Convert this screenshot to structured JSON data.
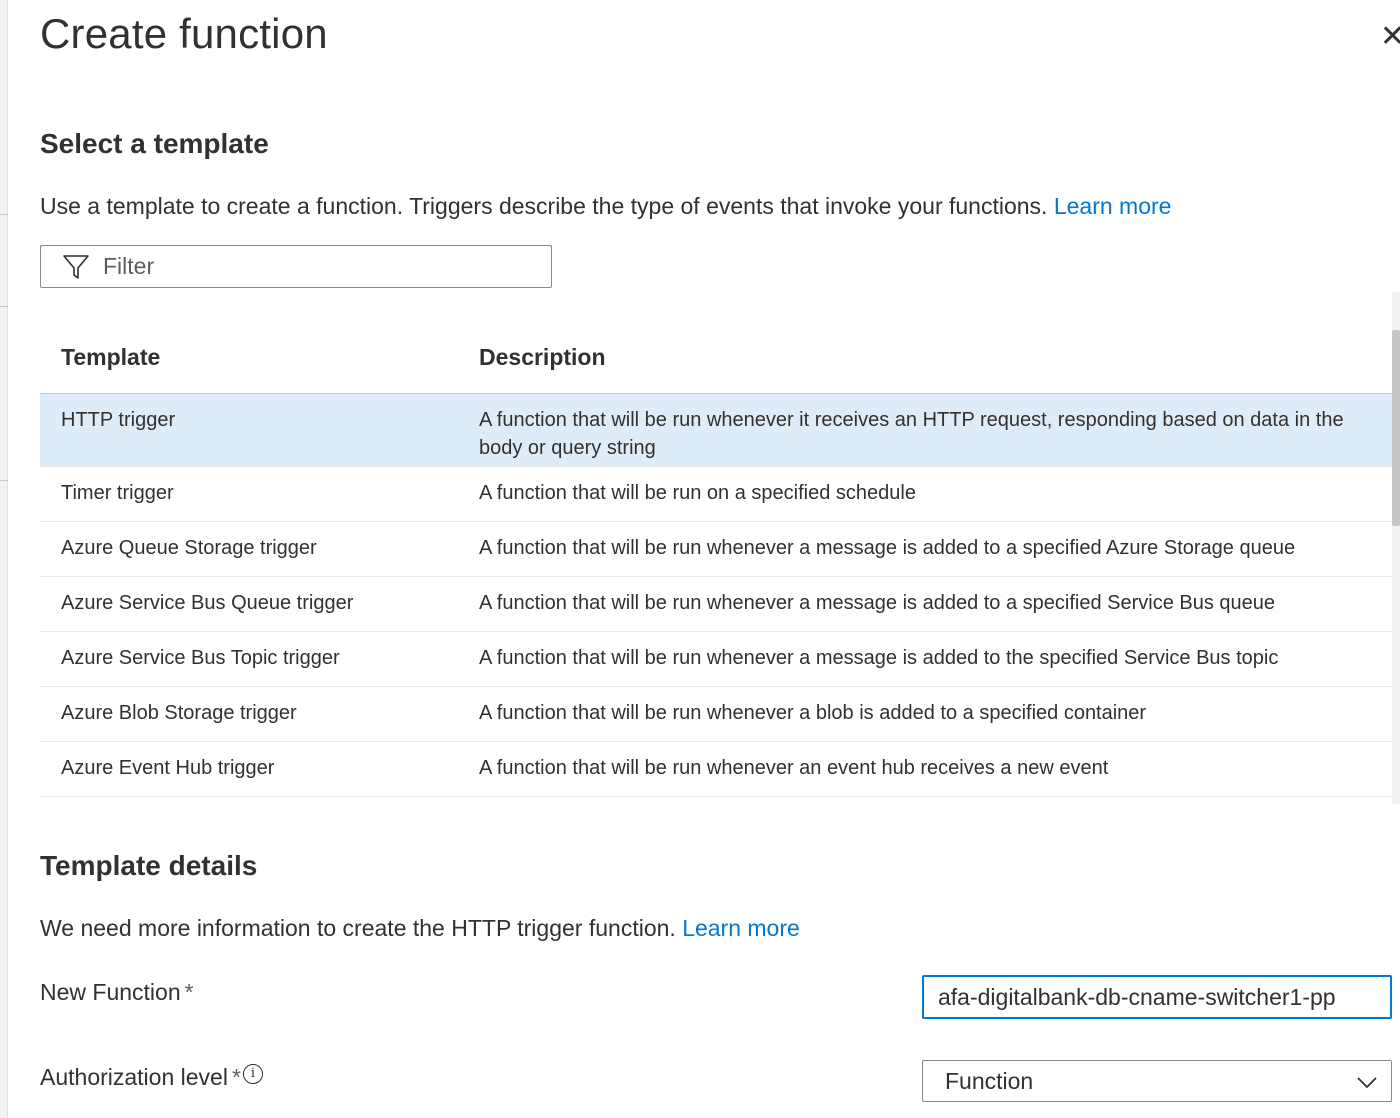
{
  "panel": {
    "title": "Create function",
    "close_glyph": "✕"
  },
  "select_template": {
    "heading": "Select a template",
    "description": "Use a template to create a function. Triggers describe the type of events that invoke your functions.",
    "learn_more": "Learn more",
    "filter_placeholder": "Filter",
    "filter_icon": "filter-icon"
  },
  "table": {
    "headers": [
      "Template",
      "Description"
    ],
    "rows": [
      {
        "template": "HTTP trigger",
        "description": "A function that will be run whenever it receives an HTTP request, responding based on data in the body or query string",
        "selected": true
      },
      {
        "template": "Timer trigger",
        "description": "A function that will be run on a specified schedule"
      },
      {
        "template": "Azure Queue Storage trigger",
        "description": "A function that will be run whenever a message is added to a specified Azure Storage queue"
      },
      {
        "template": "Azure Service Bus Queue trigger",
        "description": "A function that will be run whenever a message is added to a specified Service Bus queue"
      },
      {
        "template": "Azure Service Bus Topic trigger",
        "description": "A function that will be run whenever a message is added to the specified Service Bus topic"
      },
      {
        "template": "Azure Blob Storage trigger",
        "description": "A function that will be run whenever a blob is added to a specified container"
      },
      {
        "template": "Azure Event Hub trigger",
        "description": "A function that will be run whenever an event hub receives a new event"
      }
    ]
  },
  "template_details": {
    "heading": "Template details",
    "description": "We need more information to create the HTTP trigger function.",
    "learn_more": "Learn more",
    "new_function_label": "New Function",
    "required_marker": "*",
    "new_function_value": "afa-digitalbank-db-cname-switcher1-pp",
    "auth_level_label": "Authorization level",
    "info_glyph": "i",
    "auth_level_value": "Function"
  },
  "colors": {
    "accent": "#0078d4",
    "selected_row": "#deecf9"
  }
}
